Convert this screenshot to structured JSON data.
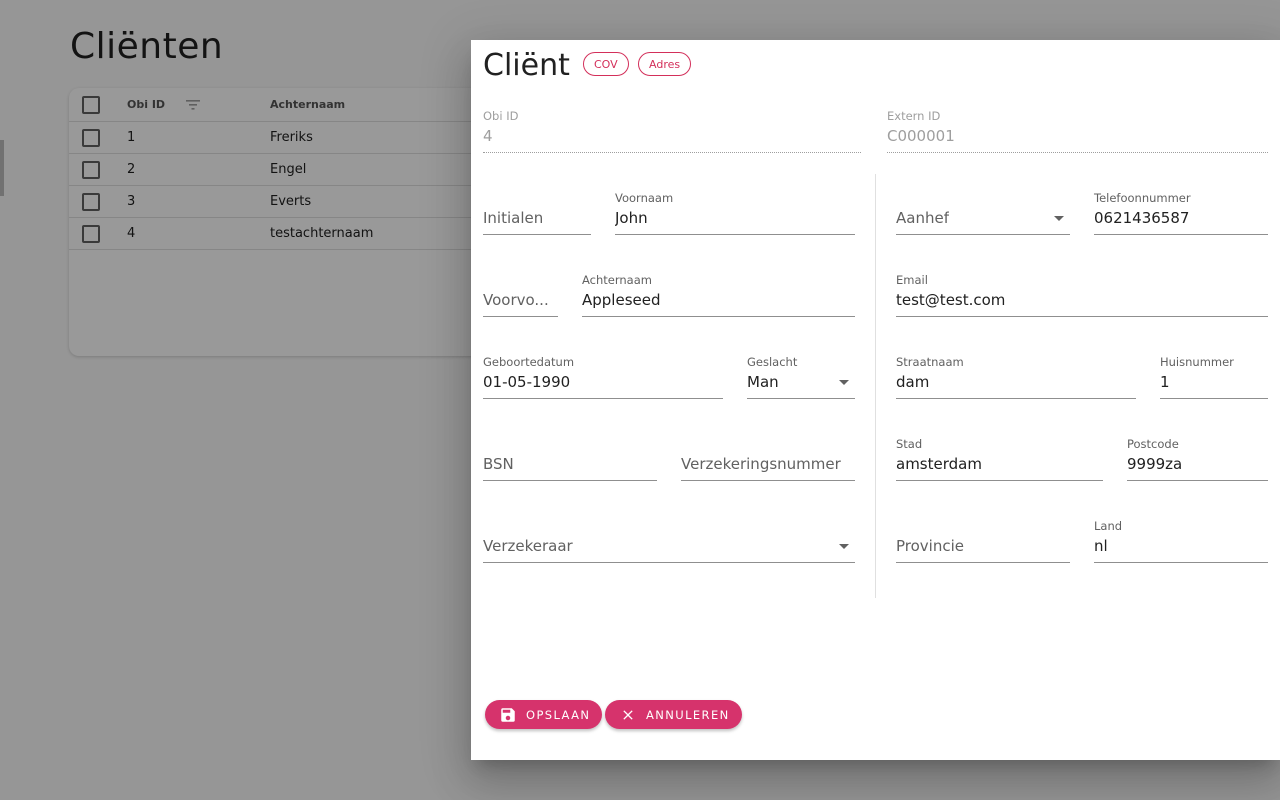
{
  "page": {
    "title": "Cliënten",
    "table": {
      "headers": {
        "obi_id": "Obi ID",
        "achternaam": "Achternaam"
      },
      "rows": [
        {
          "id": "1",
          "achternaam": "Freriks"
        },
        {
          "id": "2",
          "achternaam": "Engel"
        },
        {
          "id": "3",
          "achternaam": "Everts"
        },
        {
          "id": "4",
          "achternaam": "testachternaam"
        }
      ]
    }
  },
  "dialog": {
    "title": "Cliënt",
    "chips": {
      "cov": "COV",
      "adres": "Adres"
    },
    "obi_id": {
      "label": "Obi ID",
      "value": "4"
    },
    "extern_id": {
      "label": "Extern ID",
      "value": "C000001"
    },
    "left": {
      "initialen": {
        "placeholder": "Initialen"
      },
      "voornaam": {
        "label": "Voornaam",
        "value": "John"
      },
      "voorvoegsel": {
        "placeholder": "Voorvo..."
      },
      "achternaam": {
        "label": "Achternaam",
        "value": "Appleseed"
      },
      "geboortedatum": {
        "label": "Geboortedatum",
        "value": "01-05-1990"
      },
      "geslacht": {
        "label": "Geslacht",
        "value": "Man"
      },
      "bsn": {
        "placeholder": "BSN"
      },
      "verzekeringsnummer": {
        "placeholder": "Verzekeringsnummer"
      },
      "verzekeraar": {
        "placeholder": "Verzekeraar"
      }
    },
    "right": {
      "aanhef": {
        "placeholder": "Aanhef"
      },
      "telefoonnummer": {
        "label": "Telefoonnummer",
        "value": "0621436587"
      },
      "email": {
        "label": "Email",
        "value": "test@test.com"
      },
      "straatnaam": {
        "label": "Straatnaam",
        "value": "dam"
      },
      "huisnummer": {
        "label": "Huisnummer",
        "value": "1"
      },
      "stad": {
        "label": "Stad",
        "value": "amsterdam"
      },
      "postcode": {
        "label": "Postcode",
        "value": "9999za"
      },
      "provincie": {
        "placeholder": "Provincie"
      },
      "land": {
        "label": "Land",
        "value": "nl"
      }
    },
    "buttons": {
      "save": "OPSLAAN",
      "cancel": "ANNULEREN"
    }
  },
  "colors": {
    "accent": "#d6336c",
    "chip": "#d32f5a",
    "overlay": "rgba(0,0,0,0.40)"
  },
  "icons": {
    "save": "save-icon",
    "cancel": "close-icon",
    "filter": "filter-icon",
    "dropdown": "dropdown-arrow-icon"
  }
}
